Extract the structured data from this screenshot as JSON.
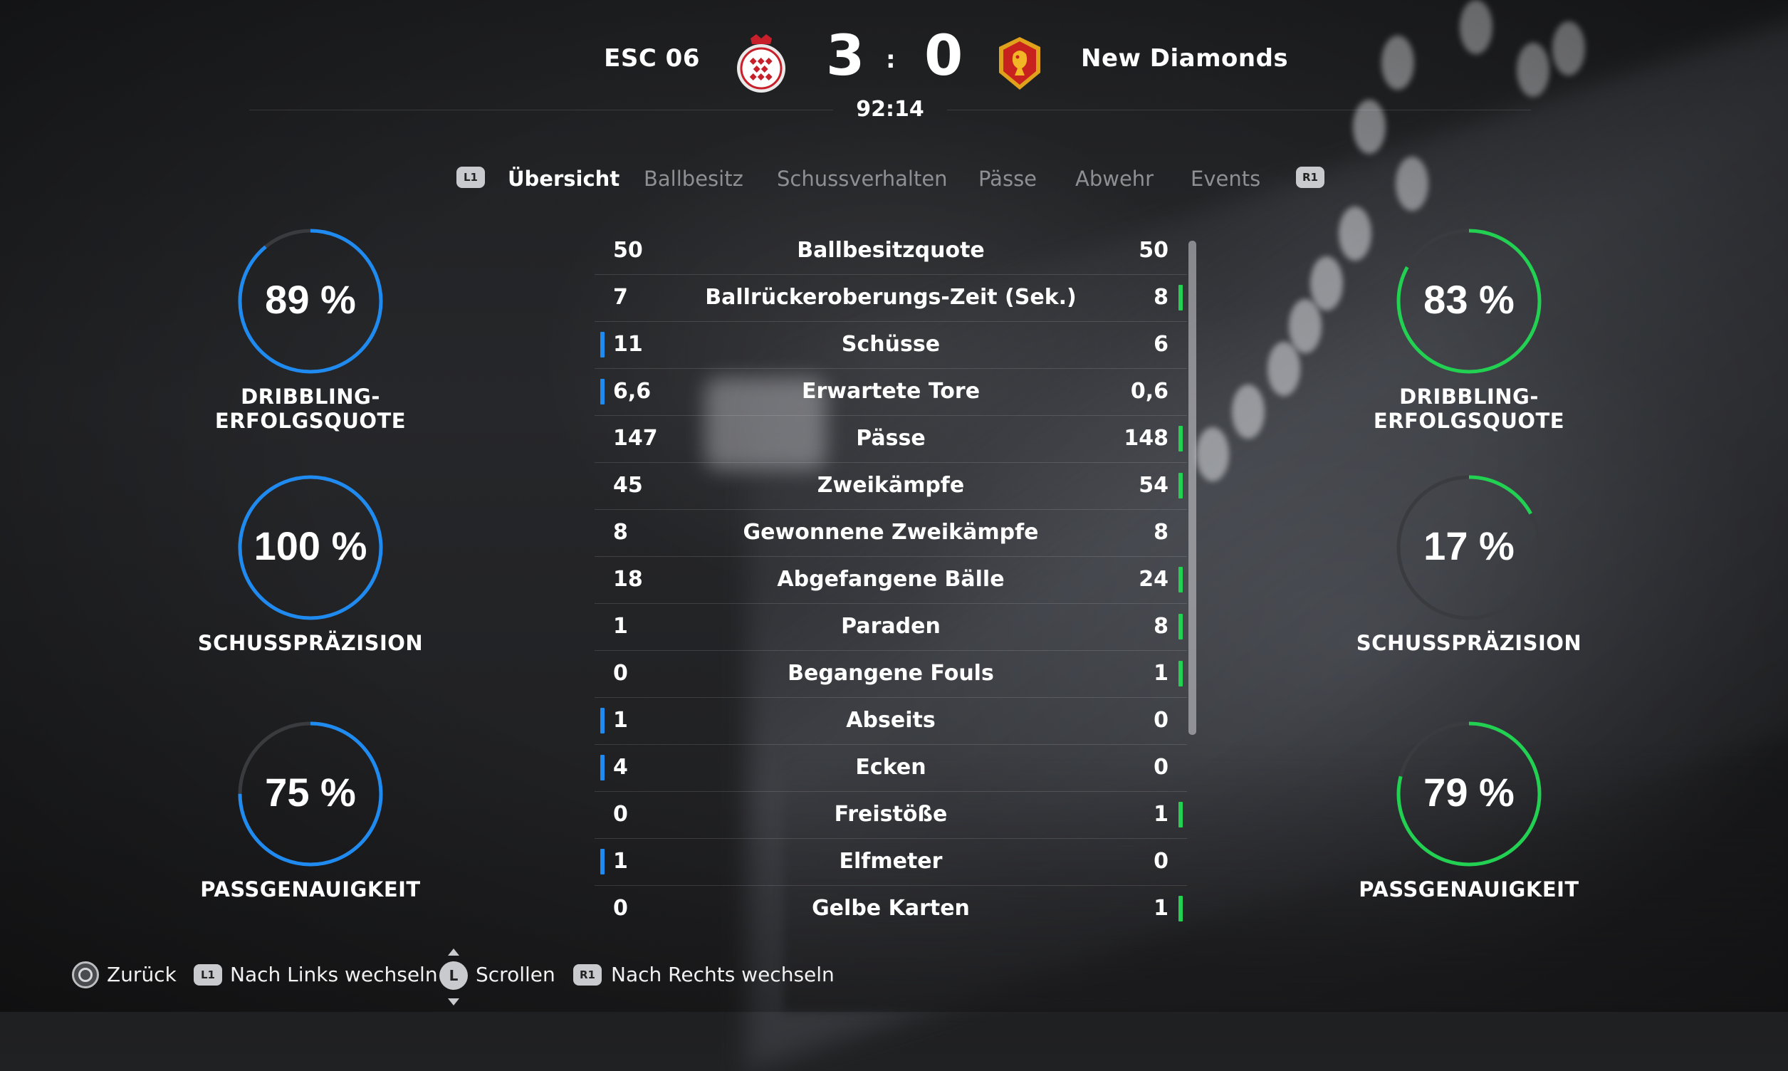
{
  "scoreboard": {
    "home_team": "ESC 06",
    "away_team": "New Diamonds",
    "home_score": "3",
    "separator": ":",
    "away_score": "0",
    "match_time": "92:14"
  },
  "tabs": {
    "left_button": "L1",
    "right_button": "R1",
    "items": [
      {
        "label": "Übersicht",
        "active": true
      },
      {
        "label": "Ballbesitz",
        "active": false
      },
      {
        "label": "Schussverhalten",
        "active": false
      },
      {
        "label": "Pässe",
        "active": false
      },
      {
        "label": "Abwehr",
        "active": false
      },
      {
        "label": "Events",
        "active": false
      }
    ]
  },
  "home_circles": [
    {
      "value": "89 %",
      "percent": 89,
      "label": "DRIBBLING-ERFOLGSQUOTE"
    },
    {
      "value": "100 %",
      "percent": 100,
      "label": "SCHUSSPRÄZISION"
    },
    {
      "value": "75 %",
      "percent": 75,
      "label": "PASSGENAUIGKEIT"
    }
  ],
  "away_circles": [
    {
      "value": "83 %",
      "percent": 83,
      "label": "DRIBBLING-ERFOLGSQUOTE"
    },
    {
      "value": "17 %",
      "percent": 17,
      "label": "SCHUSSPRÄZISION"
    },
    {
      "value": "79 %",
      "percent": 79,
      "label": "PASSGENAUIGKEIT"
    }
  ],
  "colors": {
    "home_accent": "#1f8bf0",
    "away_accent": "#22d152",
    "ring_track": "#3a3b3e"
  },
  "stats": [
    {
      "label": "Ballbesitzquote",
      "home": "50",
      "away": "50",
      "leader": "none"
    },
    {
      "label": "Ballrückeroberungs-Zeit (Sek.)",
      "home": "7",
      "away": "8",
      "leader": "away"
    },
    {
      "label": "Schüsse",
      "home": "11",
      "away": "6",
      "leader": "home"
    },
    {
      "label": "Erwartete Tore",
      "home": "6,6",
      "away": "0,6",
      "leader": "home"
    },
    {
      "label": "Pässe",
      "home": "147",
      "away": "148",
      "leader": "away"
    },
    {
      "label": "Zweikämpfe",
      "home": "45",
      "away": "54",
      "leader": "away"
    },
    {
      "label": "Gewonnene Zweikämpfe",
      "home": "8",
      "away": "8",
      "leader": "none"
    },
    {
      "label": "Abgefangene Bälle",
      "home": "18",
      "away": "24",
      "leader": "away"
    },
    {
      "label": "Paraden",
      "home": "1",
      "away": "8",
      "leader": "away"
    },
    {
      "label": "Begangene Fouls",
      "home": "0",
      "away": "1",
      "leader": "away"
    },
    {
      "label": "Abseits",
      "home": "1",
      "away": "0",
      "leader": "home"
    },
    {
      "label": "Ecken",
      "home": "4",
      "away": "0",
      "leader": "home"
    },
    {
      "label": "Freistöße",
      "home": "0",
      "away": "1",
      "leader": "away"
    },
    {
      "label": "Elfmeter",
      "home": "1",
      "away": "0",
      "leader": "home"
    },
    {
      "label": "Gelbe Karten",
      "home": "0",
      "away": "1",
      "leader": "away"
    }
  ],
  "footer": {
    "back": "Zurück",
    "left_switch_button": "L1",
    "left_switch": "Nach Links wechseln",
    "scroll_button": "L",
    "scroll": "Scrollen",
    "right_switch_button": "R1",
    "right_switch": "Nach Rechts wechseln"
  }
}
